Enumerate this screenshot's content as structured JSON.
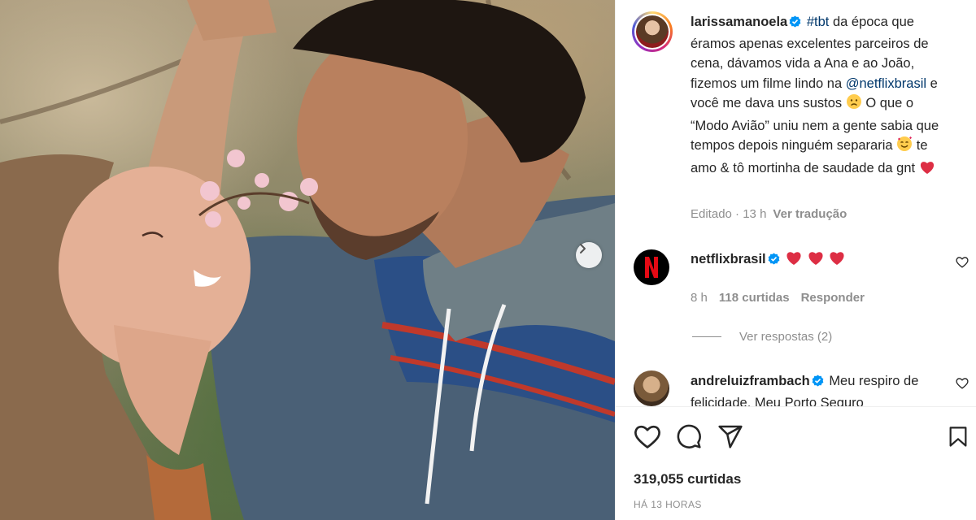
{
  "post": {
    "author": "larissamanoela",
    "caption": {
      "hashtag": "#tbt",
      "part1": " da época que éramos apenas excelentes parceiros de cena, dávamos vida a Ana e ao João, fizemos um filme lindo na ",
      "mention": "@netflixbrasil",
      "part2": " e você me dava uns sustos ",
      "part3": " O que o “Modo Avião” uniu nem a gente sabia que tempos depois ninguém separaria ",
      "part4": " te amo & tô mortinha de saudade da gnt "
    },
    "edited_label": "Editado",
    "edited_time": "13 h",
    "translate_label": "Ver tradução"
  },
  "comments": [
    {
      "username": "netflixbrasil",
      "text": "",
      "time": "8 h",
      "likes": "118 curtidas",
      "reply_label": "Responder",
      "view_replies": "Ver respostas (2)"
    },
    {
      "username": "andreluizframbach",
      "text": "Meu respiro de felicidade. Meu Porto Seguro"
    }
  ],
  "actions": {
    "like_count": "319,055 curtidas",
    "time_ago": "HÁ 13 HORAS"
  },
  "icons": [
    "verified-badge",
    "heart-icon",
    "comment-icon",
    "share-icon",
    "bookmark-icon",
    "chevron-right-icon",
    "netflix-logo"
  ],
  "colors": {
    "verified": "#0095f6",
    "heart_red": "#ed1c24",
    "netflix_red": "#e50914",
    "mention": "#00376b",
    "muted": "#8e8e8e"
  }
}
